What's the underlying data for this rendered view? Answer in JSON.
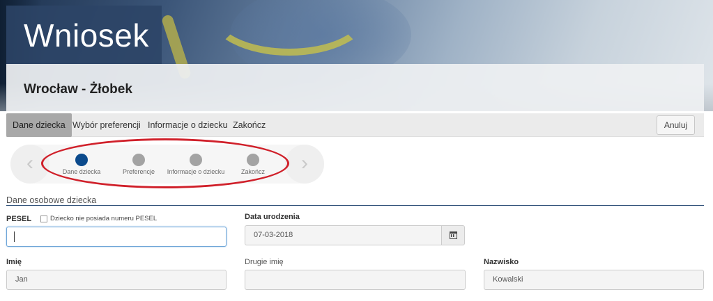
{
  "header": {
    "title": "Wniosek",
    "subtitle": "Wrocław - Żłobek"
  },
  "tabs": {
    "items": [
      {
        "label": "Dane dziecka",
        "active": true
      },
      {
        "label": "Wybór preferencji",
        "active": false
      },
      {
        "label": "Informacje o dziecku",
        "active": false
      },
      {
        "label": "Zakończ",
        "active": false
      }
    ],
    "cancel_label": "Anuluj"
  },
  "stepper": {
    "prev_icon": "chevron-left-icon",
    "next_icon": "chevron-right-icon",
    "prev_glyph": "‹",
    "next_glyph": "›",
    "steps": [
      {
        "label": "Dane dziecka",
        "active": true
      },
      {
        "label": "Preferencje",
        "active": false
      },
      {
        "label": "Informacje o dziecku",
        "active": false
      },
      {
        "label": "Zakończ",
        "active": false
      }
    ],
    "active_color": "#0b4a8c",
    "inactive_color": "#a3a3a3",
    "highlight_color": "#d0202a"
  },
  "form": {
    "section_title": "Dane osobowe dziecka",
    "pesel": {
      "label": "PESEL",
      "value": "",
      "no_pesel_label": "Dziecko nie posiada numeru PESEL"
    },
    "birth_date": {
      "label": "Data urodzenia",
      "value": "07-03-2018",
      "icon": "calendar-icon"
    },
    "first_name": {
      "label": "Imię",
      "value": "Jan"
    },
    "second_name": {
      "label": "Drugie imię",
      "value": ""
    },
    "last_name": {
      "label": "Nazwisko",
      "value": "Kowalski"
    }
  }
}
